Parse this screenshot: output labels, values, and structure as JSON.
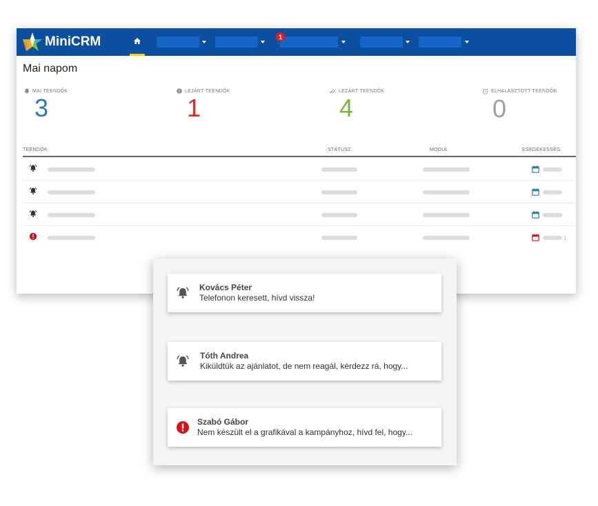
{
  "header": {
    "brand": "MiniCRM",
    "brand_color": "#0b4fa0",
    "nav_badge": "1",
    "nav_items": [
      "",
      "",
      "",
      "",
      ""
    ]
  },
  "page_title": "Mai napom",
  "stats": [
    {
      "label": "MAI TEENDŐK",
      "value": "3",
      "color": "#2a7ab0",
      "icon": "bell-icon"
    },
    {
      "label": "LEJÁRT TEENDŐK",
      "value": "1",
      "color": "#d0312d",
      "icon": "alert-circle-icon"
    },
    {
      "label": "LEZÁRT TEENDŐK",
      "value": "4",
      "color": "#7cb342",
      "icon": "double-check-icon"
    },
    {
      "label": "ELHALASZTOTT TEENDŐK",
      "value": "0",
      "color": "#9e9e9e",
      "icon": "alarm-clock-icon"
    }
  ],
  "table": {
    "headers": [
      "TEENDŐK",
      "STÁTUSZ",
      "MODUL",
      "ESEDÉKESSÉG"
    ],
    "rows": [
      {
        "type": "bell",
        "due_suffix": ""
      },
      {
        "type": "bell",
        "due_suffix": ""
      },
      {
        "type": "bell",
        "due_suffix": ""
      },
      {
        "type": "alert",
        "due_suffix": "1"
      }
    ]
  },
  "notifications": [
    {
      "name": "Kovács Péter",
      "message": "Telefonon keresett, hívd vissza!",
      "icon": "bell-icon"
    },
    {
      "name": "Tóth Andrea",
      "message": "Kiküldtük az ajánlatot, de nem reagál, kérdezz rá, hogy...",
      "icon": "bell-icon"
    },
    {
      "name": "Szabó Gábor",
      "message": "Nem készült el a grafikával a kampányhoz, hívd fel, hogy...",
      "icon": "alert-circle-icon"
    }
  ]
}
